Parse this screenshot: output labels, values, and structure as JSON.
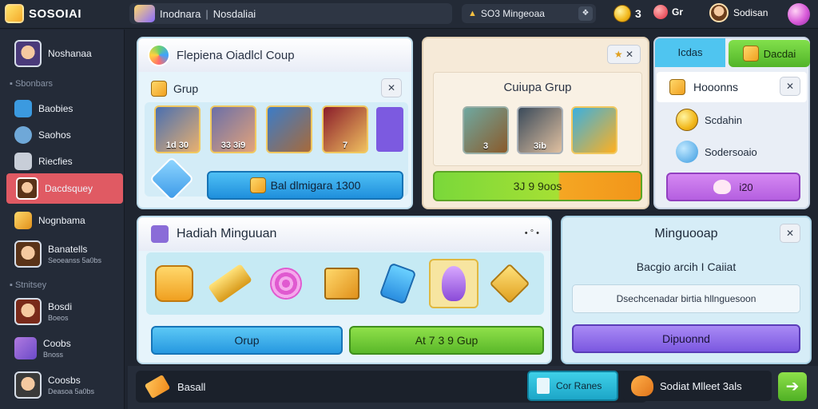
{
  "app": {
    "name": "SOSOIAI"
  },
  "topbar": {
    "crumb_1": "Inodnara",
    "crumb_sep": "|",
    "crumb_2": "Nosdaliai",
    "search_text": "SO3 Mingeoaa",
    "coins": "3",
    "gems_label": "Gr",
    "profile_name": "Sodisan"
  },
  "sidebar": {
    "user_name": "Noshanaa",
    "section_1": "Sbonbars",
    "items": [
      {
        "label": "Baobies",
        "icon": "profile-card-icon"
      },
      {
        "label": "Saohos",
        "icon": "gear-icon"
      },
      {
        "label": "Riecfies",
        "icon": "document-icon"
      },
      {
        "label": "Dacdsquey",
        "icon": "avatar-icon"
      },
      {
        "label": "Nognbama",
        "icon": "treasure-box-icon"
      }
    ],
    "friend_1": {
      "name": "Banatells",
      "sub": "Seoeanss 5a0bs"
    },
    "section_2": "Stnitsey",
    "friends": [
      {
        "name": "Bosdi",
        "sub": "Boeos"
      },
      {
        "name": "Coobs",
        "sub": "Bnoss"
      },
      {
        "name": "Coosbs",
        "sub": "Deasoa 5a0bs"
      }
    ]
  },
  "group_panel": {
    "title": "Flepiena Oiadlcl Coup",
    "subheader": "Grup",
    "close": "✕",
    "cards": [
      {
        "label": "1d 30",
        "colors": [
          "#4a6fb0",
          "#e8b070"
        ]
      },
      {
        "label": "33 3i9",
        "colors": [
          "#6b6fa8",
          "#e3a37a"
        ]
      },
      {
        "label": "",
        "colors": [
          "#3b7cc8",
          "#a86a3a"
        ]
      },
      {
        "label": "7",
        "colors": [
          "#8a1c2a",
          "#f0c060"
        ]
      }
    ],
    "action_button": "Bal dlmigara 1300"
  },
  "cup_panel": {
    "title": "Cuiupa Grup",
    "cards": [
      {
        "label": "3",
        "colors": [
          "#6fa8a0",
          "#8a5a2a"
        ]
      },
      {
        "label": "3ib",
        "colors": [
          "#3a4a5a",
          "#e0c0a0"
        ]
      },
      {
        "label": "",
        "colors": [
          "#3ab0e0",
          "#ffb020"
        ]
      }
    ],
    "action_button": "3J 9 9oos"
  },
  "side_panel": {
    "tab_a": "Icdas",
    "tab_b": "Dacdai",
    "header": "Hooonns",
    "row_1": "Scdahin",
    "row_2": "Sodersoaio",
    "button": "i20"
  },
  "weekly_panel": {
    "title": "Hadiah Minguuan",
    "dots": "• ° •",
    "rewards": [
      "gem-cluster-icon",
      "gold-bar-icon",
      "candy-icon",
      "gift-box-icon",
      "potion-bottle-icon",
      "crystal-icon",
      "gold-arrow-icon"
    ],
    "button_left": "Orup",
    "button_right": "At 7 3 9 Gup"
  },
  "right_panel": {
    "title": "Minguooap",
    "subtitle": "Bacgio arcih I Caiiat",
    "input_text": "Dsechcenadar birtia hllnguesoon",
    "button": "Dipuonnd"
  },
  "bottombar": {
    "chat_text": "Basall",
    "btn_1": "Cor Ranes",
    "btn_2": "Sodiat Mlleet 3als",
    "arrow": "➔"
  },
  "colors": {
    "active_item": "#e05a63",
    "green_btn": "#6bc83a",
    "blue_btn": "#2f9fe4",
    "purple_btn": "#7b58e0"
  }
}
